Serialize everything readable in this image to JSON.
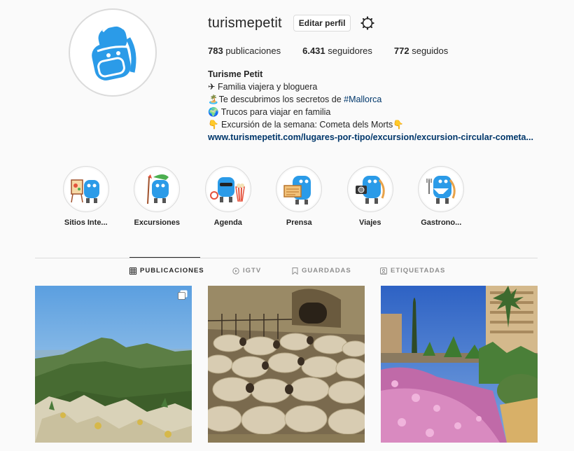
{
  "profile": {
    "username": "turismepetit",
    "edit_label": "Editar perfil",
    "stats": {
      "posts_count": "783",
      "posts_label": "publicaciones",
      "followers_count": "6.431",
      "followers_label": "seguidores",
      "following_count": "772",
      "following_label": "seguidos"
    },
    "bio": {
      "full_name": "Turisme Petit",
      "line1": "✈ Familia viajera y bloguera",
      "line2_prefix": "🏝️Te descubrimos los secretos de ",
      "line2_tag": "#Mallorca",
      "line3": "🌍 Trucos para viajar en familia",
      "line4": "👇 Excursión de la semana: Cometa dels Morts👇",
      "link": "www.turismepetit.com/lugares-por-tipo/excursion/excursion-circular-cometa..."
    }
  },
  "highlights": [
    {
      "label": "Sitios Inte..."
    },
    {
      "label": "Excursiones"
    },
    {
      "label": "Agenda"
    },
    {
      "label": "Prensa"
    },
    {
      "label": "Viajes"
    },
    {
      "label": "Gastrono..."
    }
  ],
  "tabs": [
    {
      "label": "PUBLICACIONES",
      "icon": "grid-icon",
      "active": true
    },
    {
      "label": "IGTV",
      "icon": "igtv-icon",
      "active": false
    },
    {
      "label": "GUARDADAS",
      "icon": "bookmark-icon",
      "active": false
    },
    {
      "label": "ETIQUETADAS",
      "icon": "tagged-icon",
      "active": false
    }
  ],
  "colors": {
    "mascot_blue": "#2b9be8",
    "link_blue": "#00376b",
    "border": "#dbdbdb",
    "text": "#262626",
    "muted": "#8e8e8e"
  }
}
